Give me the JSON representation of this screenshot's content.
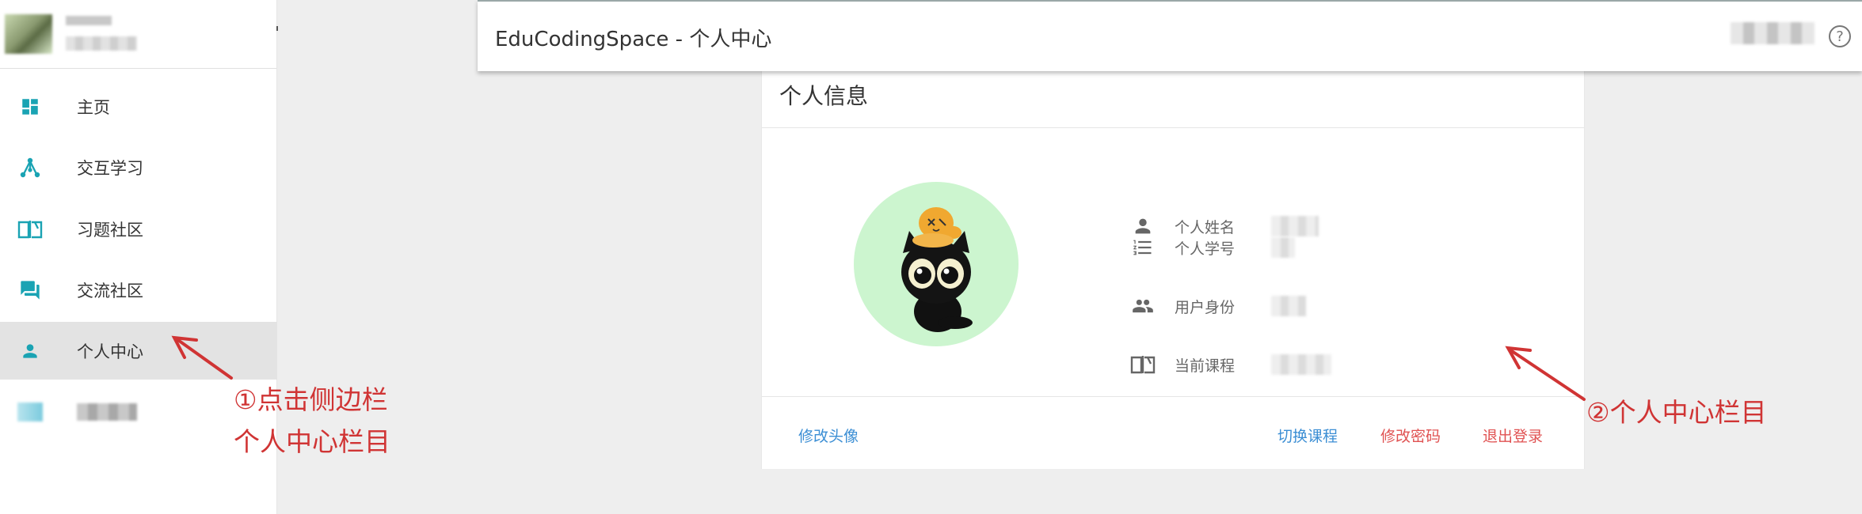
{
  "sidebar": {
    "items": [
      {
        "label": "主页",
        "icon": "dashboard-icon"
      },
      {
        "label": "交互学习",
        "icon": "share-graph-icon"
      },
      {
        "label": "习题社区",
        "icon": "open-book-icon"
      },
      {
        "label": "交流社区",
        "icon": "forum-icon"
      },
      {
        "label": "个人中心",
        "icon": "person-icon",
        "active": true
      }
    ]
  },
  "topbar": {
    "title": "EduCodingSpace - 个人中心",
    "help_symbol": "?"
  },
  "card": {
    "title": "个人信息",
    "fields": [
      {
        "label": "个人姓名",
        "icon": "person-icon"
      },
      {
        "label": "个人学号",
        "icon": "numbered-list-icon"
      },
      {
        "label": "用户身份",
        "icon": "group-icon"
      },
      {
        "label": "当前课程",
        "icon": "open-book-icon"
      }
    ],
    "actions": {
      "change_avatar": "修改头像",
      "switch_course": "切换课程",
      "change_password": "修改密码",
      "logout": "退出登录"
    }
  },
  "annotations": {
    "step1_line1": "①点击侧边栏",
    "step1_line2": "个人中心栏目",
    "step2": "②个人中心栏目"
  },
  "colors": {
    "accent": "#1aa3b3",
    "link_blue": "#3b8ed4",
    "link_red": "#e05252",
    "annotation_red": "#d03434",
    "avatar_bg": "#ccf5cf"
  }
}
